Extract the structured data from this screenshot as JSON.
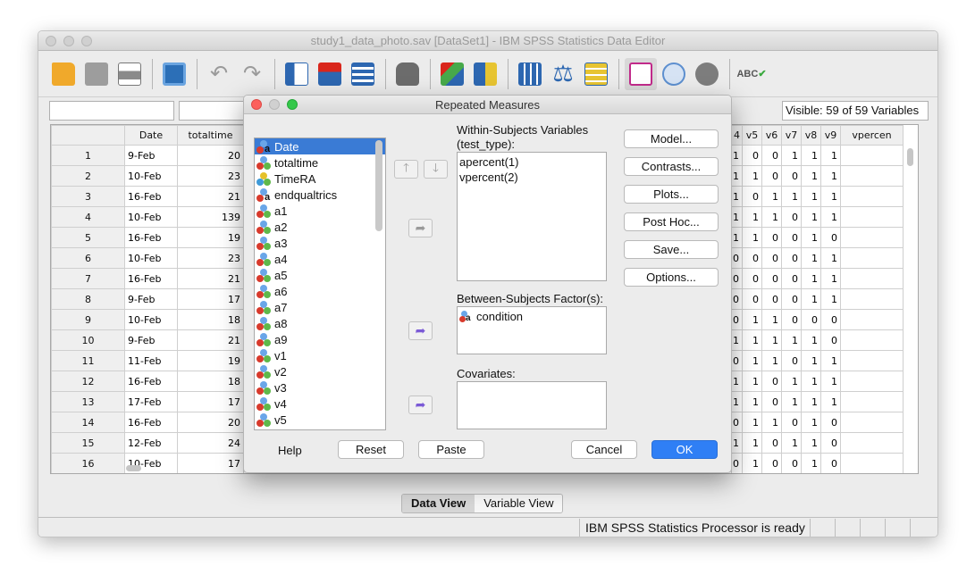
{
  "window": {
    "title": "study1_data_photo.sav [DataSet1] - IBM SPSS Statistics Data Editor"
  },
  "cellbar": {
    "visible_label": "Visible: 59 of 59 Variables"
  },
  "grid": {
    "left_headers": [
      "Date",
      "totaltime"
    ],
    "right_headers": [
      "4",
      "v5",
      "v6",
      "v7",
      "v8",
      "v9",
      "vpercen"
    ],
    "rows": [
      {
        "n": "1",
        "date": "9-Feb",
        "tt": "20",
        "r": [
          "1",
          "0",
          "0",
          "1",
          "1",
          "1"
        ]
      },
      {
        "n": "2",
        "date": "10-Feb",
        "tt": "23",
        "r": [
          "1",
          "1",
          "0",
          "0",
          "1",
          "1"
        ]
      },
      {
        "n": "3",
        "date": "16-Feb",
        "tt": "21",
        "r": [
          "1",
          "0",
          "1",
          "1",
          "1",
          "1"
        ]
      },
      {
        "n": "4",
        "date": "10-Feb",
        "tt": "139",
        "r": [
          "1",
          "1",
          "1",
          "0",
          "1",
          "1"
        ]
      },
      {
        "n": "5",
        "date": "16-Feb",
        "tt": "19",
        "r": [
          "1",
          "1",
          "0",
          "0",
          "1",
          "0"
        ]
      },
      {
        "n": "6",
        "date": "10-Feb",
        "tt": "23",
        "r": [
          "0",
          "0",
          "0",
          "0",
          "1",
          "1"
        ]
      },
      {
        "n": "7",
        "date": "16-Feb",
        "tt": "21",
        "r": [
          "0",
          "0",
          "0",
          "0",
          "1",
          "1"
        ]
      },
      {
        "n": "8",
        "date": "9-Feb",
        "tt": "17",
        "r": [
          "0",
          "0",
          "0",
          "0",
          "1",
          "1"
        ]
      },
      {
        "n": "9",
        "date": "10-Feb",
        "tt": "18",
        "r": [
          "0",
          "1",
          "1",
          "0",
          "0",
          "0"
        ]
      },
      {
        "n": "10",
        "date": "9-Feb",
        "tt": "21",
        "r": [
          "1",
          "1",
          "1",
          "1",
          "1",
          "0"
        ]
      },
      {
        "n": "11",
        "date": "11-Feb",
        "tt": "19",
        "r": [
          "0",
          "1",
          "1",
          "0",
          "1",
          "1"
        ]
      },
      {
        "n": "12",
        "date": "16-Feb",
        "tt": "18",
        "r": [
          "1",
          "1",
          "0",
          "1",
          "1",
          "1"
        ]
      },
      {
        "n": "13",
        "date": "17-Feb",
        "tt": "17",
        "r": [
          "1",
          "1",
          "0",
          "1",
          "1",
          "1"
        ]
      },
      {
        "n": "14",
        "date": "16-Feb",
        "tt": "20",
        "r": [
          "0",
          "1",
          "1",
          "0",
          "1",
          "0"
        ]
      },
      {
        "n": "15",
        "date": "12-Feb",
        "tt": "24",
        "r": [
          "1",
          "1",
          "0",
          "1",
          "1",
          "0"
        ]
      },
      {
        "n": "16",
        "date": "10-Feb",
        "tt": "17",
        "r": [
          "0",
          "1",
          "0",
          "0",
          "1",
          "0"
        ]
      }
    ]
  },
  "tabs": {
    "data_view": "Data View",
    "variable_view": "Variable View"
  },
  "status": {
    "text": "IBM SPSS Statistics Processor is ready"
  },
  "dialog": {
    "title": "Repeated Measures",
    "variables": [
      {
        "name": "Date",
        "icon": "nominal-string-icon",
        "selected": true
      },
      {
        "name": "totaltime",
        "icon": "nominal-icon"
      },
      {
        "name": "TimeRA",
        "icon": "scale-icon"
      },
      {
        "name": "endqualtrics",
        "icon": "nominal-string-icon"
      },
      {
        "name": "a1",
        "icon": "nominal-icon"
      },
      {
        "name": "a2",
        "icon": "nominal-icon"
      },
      {
        "name": "a3",
        "icon": "nominal-icon"
      },
      {
        "name": "a4",
        "icon": "nominal-icon"
      },
      {
        "name": "a5",
        "icon": "nominal-icon"
      },
      {
        "name": "a6",
        "icon": "nominal-icon"
      },
      {
        "name": "a7",
        "icon": "nominal-icon"
      },
      {
        "name": "a8",
        "icon": "nominal-icon"
      },
      {
        "name": "a9",
        "icon": "nominal-icon"
      },
      {
        "name": "v1",
        "icon": "nominal-icon"
      },
      {
        "name": "v2",
        "icon": "nominal-icon"
      },
      {
        "name": "v3",
        "icon": "nominal-icon"
      },
      {
        "name": "v4",
        "icon": "nominal-icon"
      },
      {
        "name": "v5",
        "icon": "nominal-icon"
      }
    ],
    "within_label_1": "Within-Subjects Variables",
    "within_label_2": "(test_type):",
    "within_items": [
      "apercent(1)",
      "vpercent(2)"
    ],
    "between_label": "Between-Subjects Factor(s):",
    "between_items": [
      "condition"
    ],
    "covariates_label": "Covariates:",
    "buttons": {
      "model": "Model...",
      "contrasts": "Contrasts...",
      "plots": "Plots...",
      "posthoc": "Post Hoc...",
      "save": "Save...",
      "options": "Options..."
    },
    "bottom": {
      "help": "Help",
      "reset": "Reset",
      "paste": "Paste",
      "cancel": "Cancel",
      "ok": "OK"
    }
  }
}
